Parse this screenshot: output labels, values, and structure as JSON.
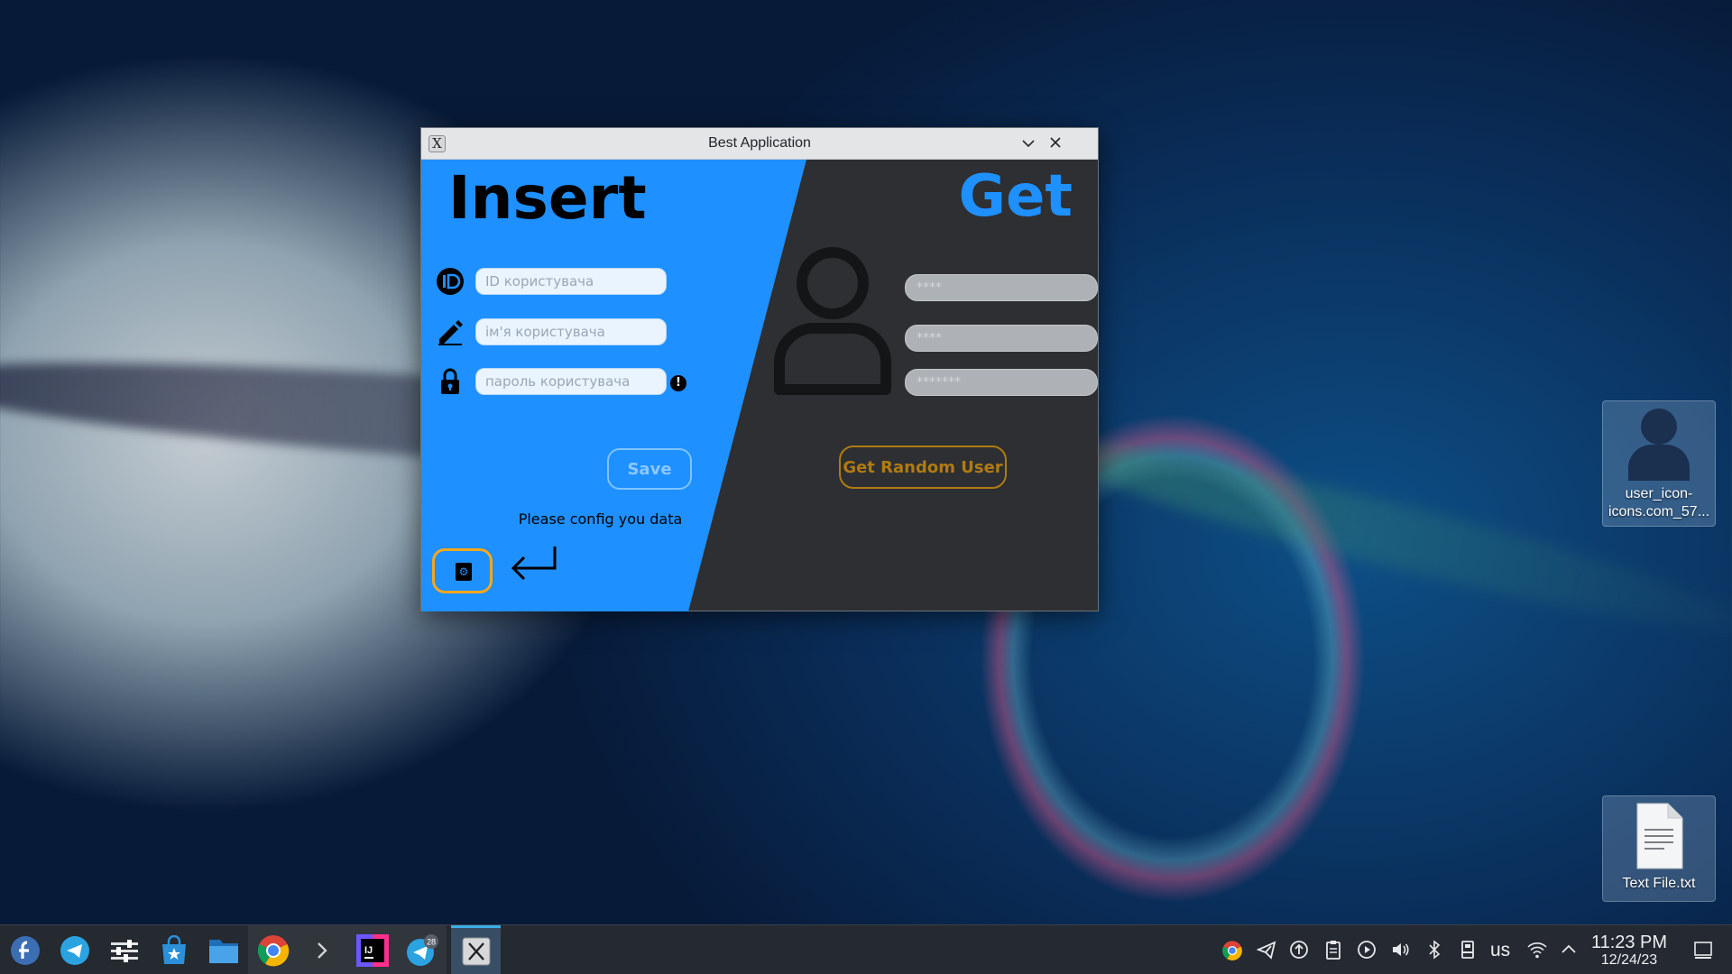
{
  "window": {
    "title": "Best Application",
    "app_icon_glyph": "X",
    "minimize_glyph": "⌄",
    "close_glyph": "✕"
  },
  "insert_panel": {
    "heading": "Insert",
    "id_placeholder": "ID користувача",
    "name_placeholder": "ім'я користувача",
    "password_placeholder": "пароль користувача",
    "warning_glyph": "!",
    "save_label": "Save",
    "status_text": "Please config you data",
    "accent_color": "#1e90ff"
  },
  "get_panel": {
    "heading": "Get",
    "field1_value": "****",
    "field2_value": "****",
    "field3_value": "*******",
    "random_user_label": "Get Random User",
    "button_color": "#b07b12"
  },
  "desktop": {
    "icons": [
      {
        "label_line1": "user_icon-",
        "label_line2": "icons.com_57...",
        "icon": "user-image-icon"
      },
      {
        "label_line1": "Text File.txt",
        "icon": "text-file-icon"
      }
    ]
  },
  "taskbar": {
    "telegram_badge": "28",
    "tray_keyboard_layout": "us",
    "time": "11:23 PM",
    "date": "12/24/23",
    "pinned": [
      "fedora-launcher-icon",
      "telegram-icon",
      "system-settings-icon",
      "discover-store-icon",
      "file-manager-icon",
      "chrome-icon",
      "terminal-icon",
      "intellij-icon",
      "telegram-chat-icon",
      "java-x-app-icon"
    ]
  }
}
